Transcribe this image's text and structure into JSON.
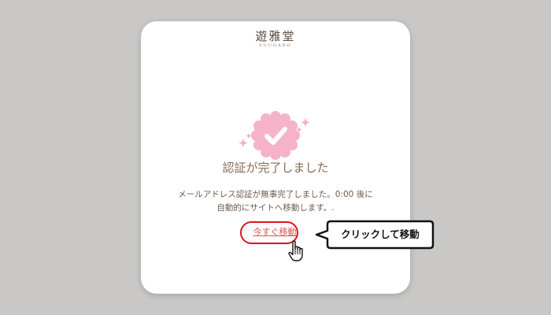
{
  "brand": {
    "name": "遊雅堂",
    "romanized": "YUUGADO"
  },
  "verification": {
    "title": "認証が完了しました",
    "message_line1": "メールアドレス認証が無事完了しました。0:00 後に",
    "message_line2": "自動的にサイトへ移動します。.",
    "link_label": "今すぐ移動"
  },
  "annotation": {
    "callout_text": "クリックして移動"
  },
  "icons": {
    "badge": "check-badge-icon",
    "cursor": "hand-pointer-icon"
  },
  "colors": {
    "background": "#c9c8c7",
    "badge_pink": "#f6b3c8",
    "sparkle_pink": "#f7a9c3",
    "title_brown": "#8a6a55",
    "link_red": "#d9534f",
    "highlight_red": "#e0141e"
  }
}
